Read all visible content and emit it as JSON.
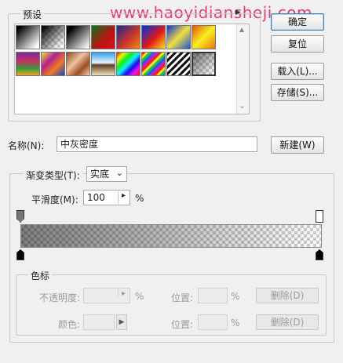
{
  "watermark": "www.haoyidiansheji.com",
  "presets": {
    "legend": "预设",
    "menu_glyph": "▶",
    "scroll_up_glyph": "▲",
    "scroll_down_glyph": "⌄"
  },
  "buttons": {
    "ok": "确定",
    "reset": "复位",
    "load": "载入(L)...",
    "save": "存储(S)...",
    "new": "新建(W)",
    "delete_opacity": "删除(D)",
    "delete_color": "删除(D)"
  },
  "name": {
    "label": "名称(N):",
    "value": "中灰密度"
  },
  "gradient": {
    "type_label": "渐变类型(T):",
    "type_value": "实底",
    "type_arrow": "⌄",
    "smoothness_label": "平滑度(M):",
    "smoothness_value": "100",
    "smoothness_arrow": "▸",
    "percent": "%"
  },
  "stops": {
    "legend": "色标",
    "opacity_label": "不透明度:",
    "opacity_arrow": "▸",
    "opacity_unit": "%",
    "location_label_1": "位置:",
    "location_unit_1": "%",
    "color_label": "颜色:",
    "color_arrow": "▶",
    "location_label_2": "位置:",
    "location_unit_2": "%"
  },
  "swatch_icons": [
    "gradient-swatch"
  ],
  "colors": {
    "accent_pink": "#e83a7a",
    "default_button_border": "#3c7fb1"
  }
}
